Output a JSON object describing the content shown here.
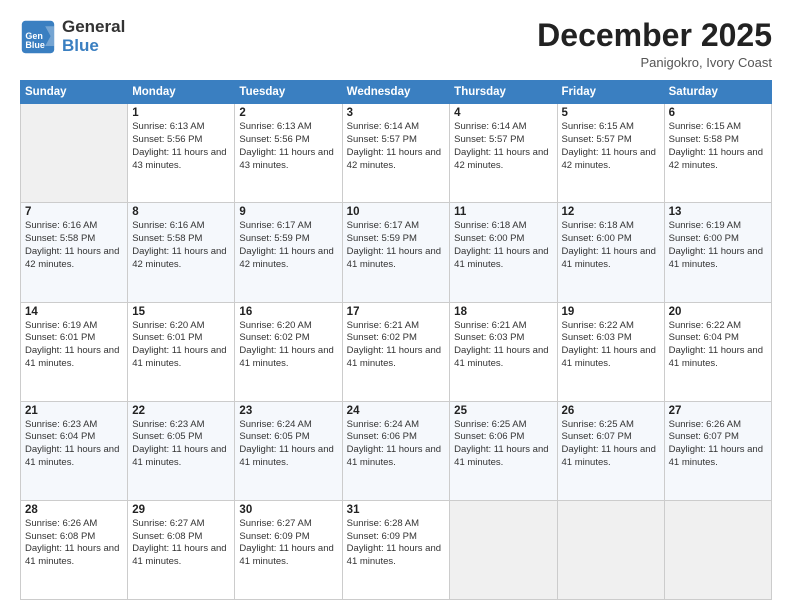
{
  "logo": {
    "general": "General",
    "blue": "Blue"
  },
  "header": {
    "title": "December 2025",
    "subtitle": "Panigokro, Ivory Coast"
  },
  "calendar": {
    "columns": [
      "Sunday",
      "Monday",
      "Tuesday",
      "Wednesday",
      "Thursday",
      "Friday",
      "Saturday"
    ],
    "rows": [
      [
        {
          "day": "",
          "sunrise": "",
          "sunset": "",
          "daylight": ""
        },
        {
          "day": "1",
          "sunrise": "Sunrise: 6:13 AM",
          "sunset": "Sunset: 5:56 PM",
          "daylight": "Daylight: 11 hours and 43 minutes."
        },
        {
          "day": "2",
          "sunrise": "Sunrise: 6:13 AM",
          "sunset": "Sunset: 5:56 PM",
          "daylight": "Daylight: 11 hours and 43 minutes."
        },
        {
          "day": "3",
          "sunrise": "Sunrise: 6:14 AM",
          "sunset": "Sunset: 5:57 PM",
          "daylight": "Daylight: 11 hours and 42 minutes."
        },
        {
          "day": "4",
          "sunrise": "Sunrise: 6:14 AM",
          "sunset": "Sunset: 5:57 PM",
          "daylight": "Daylight: 11 hours and 42 minutes."
        },
        {
          "day": "5",
          "sunrise": "Sunrise: 6:15 AM",
          "sunset": "Sunset: 5:57 PM",
          "daylight": "Daylight: 11 hours and 42 minutes."
        },
        {
          "day": "6",
          "sunrise": "Sunrise: 6:15 AM",
          "sunset": "Sunset: 5:58 PM",
          "daylight": "Daylight: 11 hours and 42 minutes."
        }
      ],
      [
        {
          "day": "7",
          "sunrise": "Sunrise: 6:16 AM",
          "sunset": "Sunset: 5:58 PM",
          "daylight": "Daylight: 11 hours and 42 minutes."
        },
        {
          "day": "8",
          "sunrise": "Sunrise: 6:16 AM",
          "sunset": "Sunset: 5:58 PM",
          "daylight": "Daylight: 11 hours and 42 minutes."
        },
        {
          "day": "9",
          "sunrise": "Sunrise: 6:17 AM",
          "sunset": "Sunset: 5:59 PM",
          "daylight": "Daylight: 11 hours and 42 minutes."
        },
        {
          "day": "10",
          "sunrise": "Sunrise: 6:17 AM",
          "sunset": "Sunset: 5:59 PM",
          "daylight": "Daylight: 11 hours and 41 minutes."
        },
        {
          "day": "11",
          "sunrise": "Sunrise: 6:18 AM",
          "sunset": "Sunset: 6:00 PM",
          "daylight": "Daylight: 11 hours and 41 minutes."
        },
        {
          "day": "12",
          "sunrise": "Sunrise: 6:18 AM",
          "sunset": "Sunset: 6:00 PM",
          "daylight": "Daylight: 11 hours and 41 minutes."
        },
        {
          "day": "13",
          "sunrise": "Sunrise: 6:19 AM",
          "sunset": "Sunset: 6:00 PM",
          "daylight": "Daylight: 11 hours and 41 minutes."
        }
      ],
      [
        {
          "day": "14",
          "sunrise": "Sunrise: 6:19 AM",
          "sunset": "Sunset: 6:01 PM",
          "daylight": "Daylight: 11 hours and 41 minutes."
        },
        {
          "day": "15",
          "sunrise": "Sunrise: 6:20 AM",
          "sunset": "Sunset: 6:01 PM",
          "daylight": "Daylight: 11 hours and 41 minutes."
        },
        {
          "day": "16",
          "sunrise": "Sunrise: 6:20 AM",
          "sunset": "Sunset: 6:02 PM",
          "daylight": "Daylight: 11 hours and 41 minutes."
        },
        {
          "day": "17",
          "sunrise": "Sunrise: 6:21 AM",
          "sunset": "Sunset: 6:02 PM",
          "daylight": "Daylight: 11 hours and 41 minutes."
        },
        {
          "day": "18",
          "sunrise": "Sunrise: 6:21 AM",
          "sunset": "Sunset: 6:03 PM",
          "daylight": "Daylight: 11 hours and 41 minutes."
        },
        {
          "day": "19",
          "sunrise": "Sunrise: 6:22 AM",
          "sunset": "Sunset: 6:03 PM",
          "daylight": "Daylight: 11 hours and 41 minutes."
        },
        {
          "day": "20",
          "sunrise": "Sunrise: 6:22 AM",
          "sunset": "Sunset: 6:04 PM",
          "daylight": "Daylight: 11 hours and 41 minutes."
        }
      ],
      [
        {
          "day": "21",
          "sunrise": "Sunrise: 6:23 AM",
          "sunset": "Sunset: 6:04 PM",
          "daylight": "Daylight: 11 hours and 41 minutes."
        },
        {
          "day": "22",
          "sunrise": "Sunrise: 6:23 AM",
          "sunset": "Sunset: 6:05 PM",
          "daylight": "Daylight: 11 hours and 41 minutes."
        },
        {
          "day": "23",
          "sunrise": "Sunrise: 6:24 AM",
          "sunset": "Sunset: 6:05 PM",
          "daylight": "Daylight: 11 hours and 41 minutes."
        },
        {
          "day": "24",
          "sunrise": "Sunrise: 6:24 AM",
          "sunset": "Sunset: 6:06 PM",
          "daylight": "Daylight: 11 hours and 41 minutes."
        },
        {
          "day": "25",
          "sunrise": "Sunrise: 6:25 AM",
          "sunset": "Sunset: 6:06 PM",
          "daylight": "Daylight: 11 hours and 41 minutes."
        },
        {
          "day": "26",
          "sunrise": "Sunrise: 6:25 AM",
          "sunset": "Sunset: 6:07 PM",
          "daylight": "Daylight: 11 hours and 41 minutes."
        },
        {
          "day": "27",
          "sunrise": "Sunrise: 6:26 AM",
          "sunset": "Sunset: 6:07 PM",
          "daylight": "Daylight: 11 hours and 41 minutes."
        }
      ],
      [
        {
          "day": "28",
          "sunrise": "Sunrise: 6:26 AM",
          "sunset": "Sunset: 6:08 PM",
          "daylight": "Daylight: 11 hours and 41 minutes."
        },
        {
          "day": "29",
          "sunrise": "Sunrise: 6:27 AM",
          "sunset": "Sunset: 6:08 PM",
          "daylight": "Daylight: 11 hours and 41 minutes."
        },
        {
          "day": "30",
          "sunrise": "Sunrise: 6:27 AM",
          "sunset": "Sunset: 6:09 PM",
          "daylight": "Daylight: 11 hours and 41 minutes."
        },
        {
          "day": "31",
          "sunrise": "Sunrise: 6:28 AM",
          "sunset": "Sunset: 6:09 PM",
          "daylight": "Daylight: 11 hours and 41 minutes."
        },
        {
          "day": "",
          "sunrise": "",
          "sunset": "",
          "daylight": ""
        },
        {
          "day": "",
          "sunrise": "",
          "sunset": "",
          "daylight": ""
        },
        {
          "day": "",
          "sunrise": "",
          "sunset": "",
          "daylight": ""
        }
      ]
    ]
  }
}
